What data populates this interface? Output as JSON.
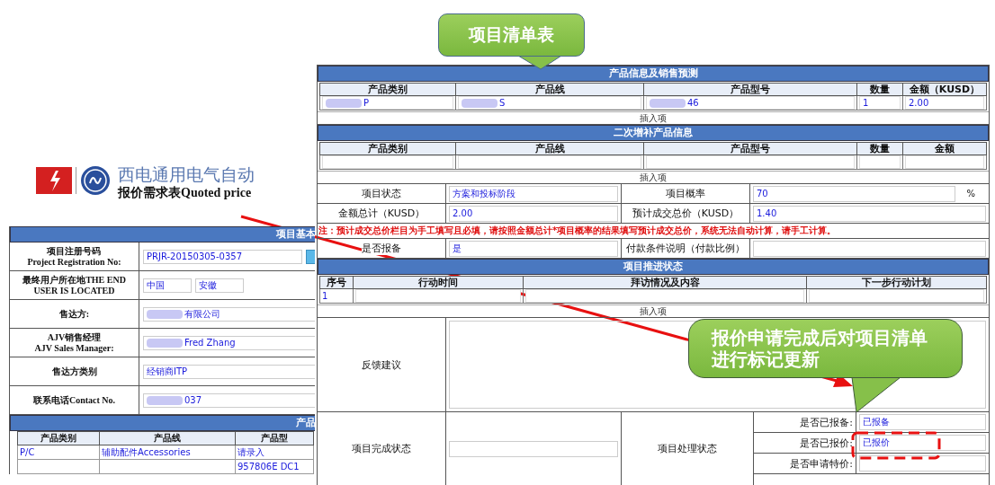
{
  "header": {
    "title": "西电通用电气自动",
    "subtitle": "报价需求表Quoted price"
  },
  "basic_info": {
    "title": "项目基本",
    "rows": [
      {
        "label": [
          "项目注册号码",
          "Project Registration No:"
        ],
        "fields": [
          {
            "value": "PRJR-20150305-0357"
          }
        ],
        "lookup": true
      },
      {
        "label": [
          "最终用户所在地THE END USER IS LOCATED"
        ],
        "fields": [
          {
            "value": "中国"
          },
          {
            "value": "安徽"
          }
        ]
      },
      {
        "label": [
          "售达方:"
        ],
        "fields": [
          {
            "value": "有限公司",
            "redacted": true
          }
        ]
      },
      {
        "label": [
          "AJV销售经理",
          "AJV Sales Manager:"
        ],
        "fields": [
          {
            "value": "Fred Zhang",
            "redacted": true
          }
        ]
      },
      {
        "label": [
          "售达方类别"
        ],
        "fields": [
          {
            "value": "经销商ITP"
          }
        ]
      },
      {
        "label": [
          "联系电话Contact No."
        ],
        "fields": [
          {
            "value": "037",
            "redacted": true
          }
        ]
      }
    ]
  },
  "product_info_left": {
    "title": "产品",
    "columns": [
      "产品类别",
      "产品线",
      "产品型"
    ],
    "rows": [
      [
        "P/C",
        "辅助配件Accessories",
        "请录入"
      ],
      [
        "",
        "",
        "957806E    DC1"
      ]
    ]
  },
  "product_forecast": {
    "title": "产品信息及销售预测",
    "columns": [
      "产品类别",
      "产品线",
      "产品型号",
      "数量",
      "金额（KUSD）"
    ],
    "rows": [
      [
        {
          "value": "P",
          "redacted": true
        },
        {
          "value": "S",
          "redacted": true
        },
        {
          "value": "46",
          "redacted": true
        },
        {
          "value": "1"
        },
        {
          "value": "2.00"
        }
      ]
    ],
    "insert_link": "插入项"
  },
  "supplementary_products": {
    "title": "二次增补产品信息",
    "columns": [
      "产品类别",
      "产品线",
      "产品型号",
      "数量",
      "金额"
    ],
    "insert_link": "插入项"
  },
  "project_fields": [
    [
      {
        "label": "项目状态",
        "value": "方案和投标阶段"
      },
      {
        "label": "项目概率",
        "value": "70",
        "unit": "%"
      }
    ],
    [
      {
        "label": "金额总计（KUSD）",
        "value": "2.00"
      },
      {
        "label": "预计成交总价（KUSD）",
        "value": "1.40"
      }
    ]
  ],
  "note": "注：预计成交总价栏目为手工填写且必填，请按照金额总计*项目概率的结果填写预计成交总价，系统无法自动计算，请手工计算。",
  "project_fields_2": [
    [
      {
        "label": "是否报备",
        "value": "是"
      },
      {
        "label": "付款条件说明（付款比例）"
      }
    ]
  ],
  "progress": {
    "title": "项目推进状态",
    "columns": [
      "序号",
      "行动时间",
      "拜访情况及内容",
      "下一步行动计划"
    ],
    "rows": [
      [
        "1"
      ]
    ],
    "insert_link": "插入项"
  },
  "feedback": {
    "label": "反馈建议"
  },
  "completion": {
    "label": "项目完成状态",
    "processing_label": "项目处理状态",
    "checks": [
      {
        "label": "是否已报备:",
        "value": "已报备"
      },
      {
        "label": "是否已报价:",
        "value": "已报价"
      },
      {
        "label": "是否申请特价:"
      }
    ]
  },
  "annotations": [
    {
      "kind": "callout",
      "text": "项目清单表"
    },
    {
      "kind": "callout",
      "text": "报价申请完成后对项目清单进行标记更新"
    }
  ]
}
